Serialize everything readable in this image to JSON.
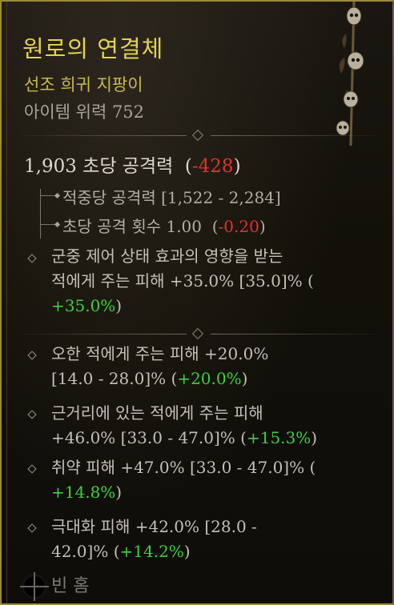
{
  "item": {
    "name": "원로의 연결체",
    "rarity_type": "선조 희귀 지팡이",
    "item_power": "아이템 위력 752"
  },
  "dps": {
    "value": "1,903 초당 공격력",
    "delta": "-428"
  },
  "substats": [
    {
      "text": "적중당 공격력 [1,522 - 2,284]"
    },
    {
      "text": "초당 공격 횟수 1.00",
      "delta": "-0.20"
    }
  ],
  "implicit": [
    {
      "line1": "군중 제어 상태 효과의 영향을 받는",
      "line2": "적에게 주는 피해 +35.0% [35.0]% (",
      "line3_pos": "+35.0%",
      "line3_tail": ")"
    }
  ],
  "affixes": [
    {
      "line1": "오한 적에게 주는 피해 +20.0%",
      "line2_pre": "[14.0 - 28.0]% (",
      "line2_pos": "+20.0%",
      "line2_tail": ")"
    },
    {
      "line1": "근거리에 있는 적에게 주는 피해",
      "line2_pre": "+46.0% [33.0 - 47.0]% (",
      "line2_pos": "+15.3%",
      "line2_tail": ")"
    },
    {
      "line1": "취약 피해 +47.0% [33.0 - 47.0]% (",
      "line2_pos": "+14.8%",
      "line2_tail": ")"
    },
    {
      "line1": "극대화 피해 +42.0% [28.0 -",
      "line2_pre": "42.0]% (",
      "line2_pos": "+14.2%",
      "line2_tail": ")"
    }
  ],
  "socket": {
    "label": "빈 홈"
  },
  "colors": {
    "title": "#e2d24f",
    "negative": "#e0332b",
    "positive": "#3ecf3e",
    "border": "#9c8a3a"
  },
  "icons": {
    "item_art": "skull-staff-icon",
    "socket": "empty-socket-icon",
    "bullet": "diamond-bullet-icon"
  }
}
